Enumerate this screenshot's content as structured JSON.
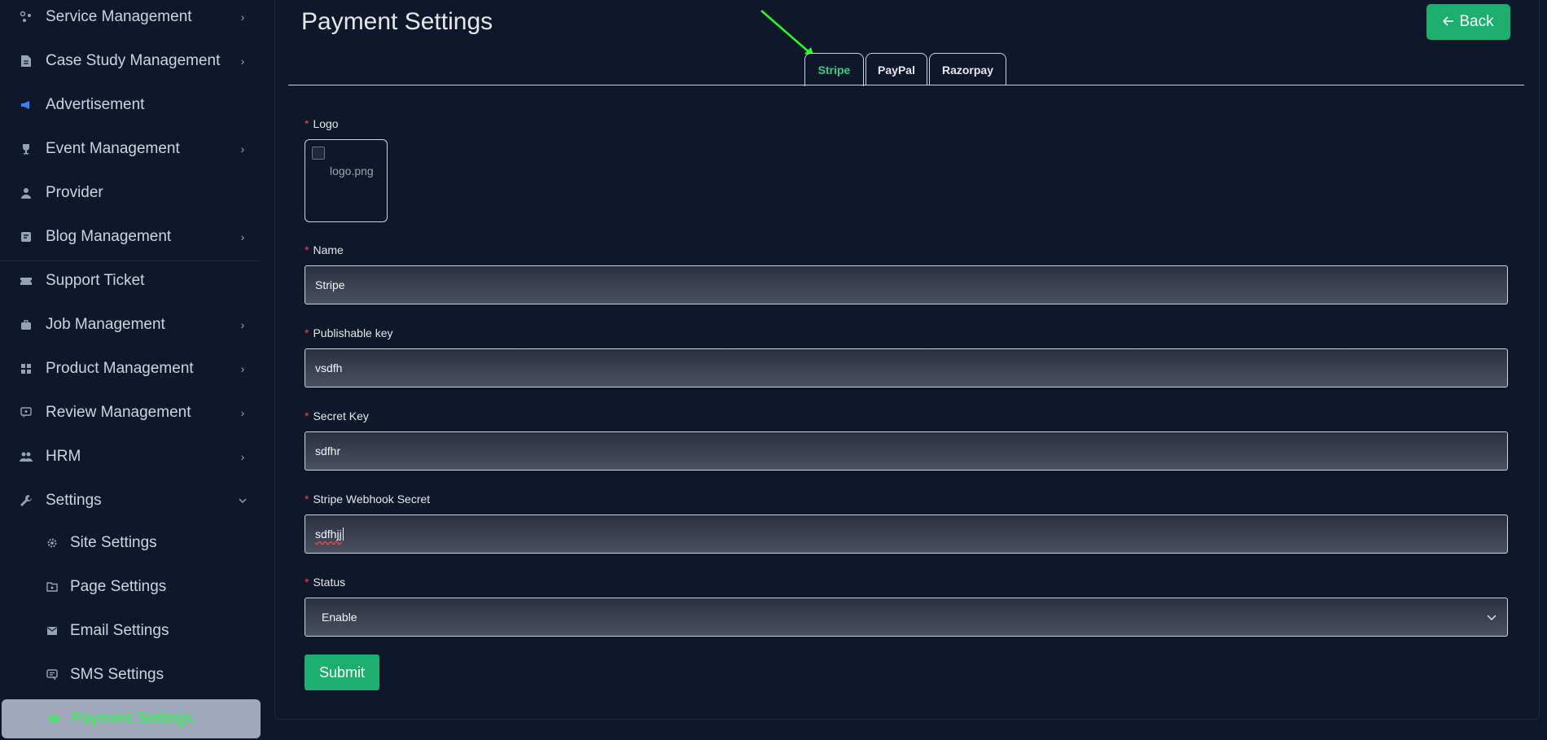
{
  "sidebar": {
    "items": [
      {
        "label": "Service Management",
        "icon": "service-icon",
        "chevron": true
      },
      {
        "label": "Case Study Management",
        "icon": "document-icon",
        "chevron": true
      },
      {
        "label": "Advertisement",
        "icon": "megaphone-icon",
        "chevron": false
      },
      {
        "label": "Event Management",
        "icon": "trophy-icon",
        "chevron": true
      },
      {
        "label": "Provider",
        "icon": "person-icon",
        "chevron": false
      },
      {
        "label": "Blog Management",
        "icon": "blog-icon",
        "chevron": true
      },
      {
        "label": "Support Ticket",
        "icon": "ticket-icon",
        "chevron": false
      },
      {
        "label": "Job Management",
        "icon": "briefcase-icon",
        "chevron": true
      },
      {
        "label": "Product Management",
        "icon": "grid-icon",
        "chevron": true
      },
      {
        "label": "Review Management",
        "icon": "review-icon",
        "chevron": true
      },
      {
        "label": "HRM",
        "icon": "users-icon",
        "chevron": true
      },
      {
        "label": "Settings",
        "icon": "wrench-icon",
        "chevron": true
      }
    ],
    "sub_items": [
      {
        "label": "Site Settings",
        "icon": "gear-icon"
      },
      {
        "label": "Page Settings",
        "icon": "page-icon"
      },
      {
        "label": "Email Settings",
        "icon": "mail-icon"
      },
      {
        "label": "SMS Settings",
        "icon": "sms-icon"
      },
      {
        "label": "Payment Settings",
        "icon": "eye-icon"
      }
    ]
  },
  "header": {
    "title": "Payment Settings",
    "back_label": "Back",
    "back_icon": "arrow-left-icon"
  },
  "tabs": [
    {
      "label": "Stripe",
      "active": true
    },
    {
      "label": "PayPal",
      "active": false
    },
    {
      "label": "Razorpay",
      "active": false
    }
  ],
  "form": {
    "logo_label": "Logo",
    "logo_alt": "logo.png",
    "name_label": "Name",
    "name_value": "Stripe",
    "publishable_label": "Publishable key",
    "publishable_value": "vsdfh",
    "secret_label": "Secret Key",
    "secret_value": "sdfhr",
    "webhook_label": "Stripe Webhook Secret",
    "webhook_value": "sdfhjj",
    "status_label": "Status",
    "status_value": "Enable",
    "required_mark": "*",
    "submit_label": "Submit"
  },
  "colors": {
    "background": "#0f172b",
    "accent": "#1cae6d",
    "active_tab": "#2fd08a",
    "required": "#ef4444",
    "annotation_arrow": "#22ff22"
  }
}
